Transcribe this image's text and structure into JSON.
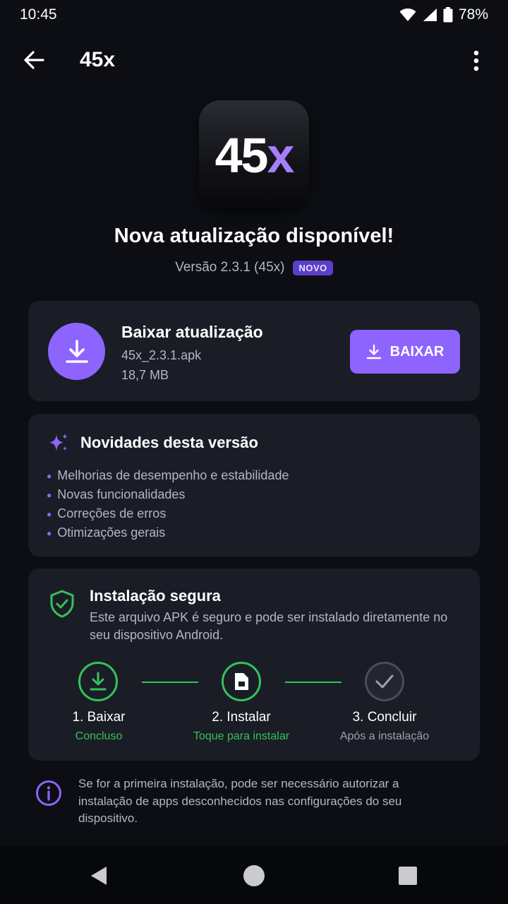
{
  "status_bar": {
    "time": "10:45",
    "battery": "78%"
  },
  "app_bar": {
    "title": "45x"
  },
  "app_icon": {
    "text_number": "45",
    "text_x": "x",
    "accent_color": "#a77dff"
  },
  "header": {
    "headline": "Nova atualização disponível!",
    "version": "Versão 2.3.1 (45x)",
    "badge": "NOVO"
  },
  "download_card": {
    "title": "Baixar atualização",
    "file_name": "45x_2.3.1.apk",
    "file_size": "18,7 MB",
    "button_label": "BAIXAR",
    "accent_color": "#8e64ff"
  },
  "news_card": {
    "title": "Novidades desta versão",
    "items": [
      "Melhorias de desempenho e estabilidade",
      "Novas funcionalidades",
      "Correções de erros",
      "Otimizações gerais"
    ]
  },
  "secure_card": {
    "title": "Instalação segura",
    "description": "Este arquivo APK é seguro e pode ser instalado diretamente no seu dispositivo Android.",
    "steps": [
      {
        "label": "1. Baixar",
        "status": "Concluso",
        "icon": "download-icon"
      },
      {
        "label": "2. Instalar",
        "status": "Toque para instalar",
        "icon": "file-icon"
      },
      {
        "label": "3. Concluir",
        "status": "Após a instalação",
        "icon": "check-icon"
      }
    ],
    "success_color": "#35c25a"
  },
  "info": {
    "text": "Se for a primeira instalação, pode ser necessário autorizar a instalação de apps desconhecidos nas configurações do seu dispositivo."
  },
  "nav_bar": {
    "icons": [
      "back-triangle-icon",
      "home-circle-icon",
      "recents-square-icon"
    ]
  }
}
